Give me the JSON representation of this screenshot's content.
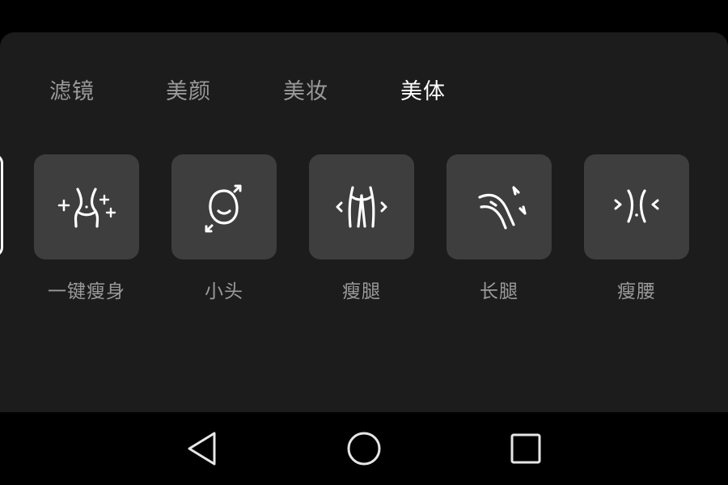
{
  "tabs": [
    {
      "label": "滤镜",
      "active": false
    },
    {
      "label": "美颜",
      "active": false
    },
    {
      "label": "美妆",
      "active": false
    },
    {
      "label": "美体",
      "active": true
    }
  ],
  "tools": [
    {
      "label": "一键瘦身",
      "icon": "slim-body-icon"
    },
    {
      "label": "小头",
      "icon": "small-head-icon"
    },
    {
      "label": "瘦腿",
      "icon": "slim-legs-icon"
    },
    {
      "label": "长腿",
      "icon": "long-legs-icon"
    },
    {
      "label": "瘦腰",
      "icon": "slim-waist-icon"
    }
  ],
  "nav": {
    "back": "back-icon",
    "home": "home-icon",
    "recents": "recents-icon"
  },
  "colors": {
    "panel": "#1c1c1c",
    "tile": "#3e3e3e",
    "text_inactive": "#9a9a9a",
    "text_active": "#ffffff",
    "icon": "#ffffff"
  }
}
